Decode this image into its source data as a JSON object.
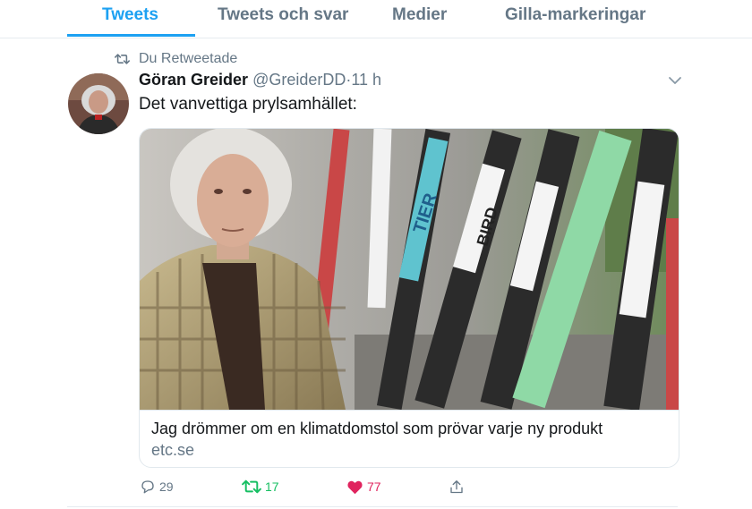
{
  "tabs": [
    {
      "label": "Tweets"
    },
    {
      "label": "Tweets och svar"
    },
    {
      "label": "Medier"
    },
    {
      "label": "Gilla-markeringar"
    }
  ],
  "tweet": {
    "retweet_note": "Du Retweetade",
    "author_name": "Göran Greider",
    "author_handle": "@GreiderDD",
    "separator": "·",
    "time": "11 h",
    "text": "Det vanvettiga prylsamhället:",
    "card": {
      "title": "Jag drömmer om en klimatdomstol som prövar varje ny produkt",
      "domain": "etc.se",
      "image_brand_texts": [
        "TIER",
        "BIRD"
      ]
    },
    "actions": {
      "replies": "29",
      "retweets": "17",
      "likes": "77"
    }
  },
  "colors": {
    "accent": "#1da1f2",
    "retweet": "#17bf63",
    "like": "#e0245e",
    "secondary_text": "#657786"
  },
  "icons": [
    "retweet-icon",
    "chevron-down-icon",
    "reply-icon",
    "like-icon",
    "share-icon"
  ]
}
